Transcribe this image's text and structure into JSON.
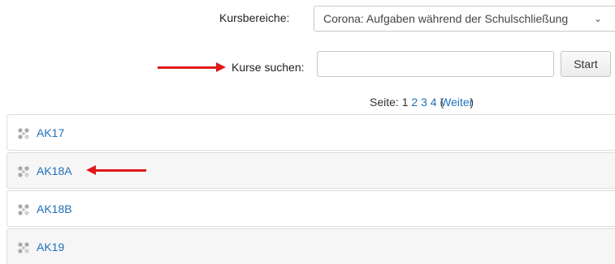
{
  "category": {
    "label": "Kursbereiche:",
    "selected": "Corona: Aufgaben während der Schulschließung"
  },
  "search": {
    "label": "Kurse suchen:",
    "value": "",
    "placeholder": "",
    "button_label": "Start"
  },
  "paging": {
    "prefix": "Seite:",
    "current": "1",
    "pages": [
      "2",
      "3",
      "4"
    ],
    "next_open": "(",
    "next_label": "Weiter",
    "next_close": ")"
  },
  "courses": [
    {
      "name": "AK17",
      "icon": "course-icon"
    },
    {
      "name": "AK18A",
      "icon": "course-icon"
    },
    {
      "name": "AK18B",
      "icon": "course-icon"
    },
    {
      "name": "AK19",
      "icon": "course-icon"
    }
  ],
  "colors": {
    "link": "#1f70b8",
    "annotation_arrow": "#e01818"
  }
}
